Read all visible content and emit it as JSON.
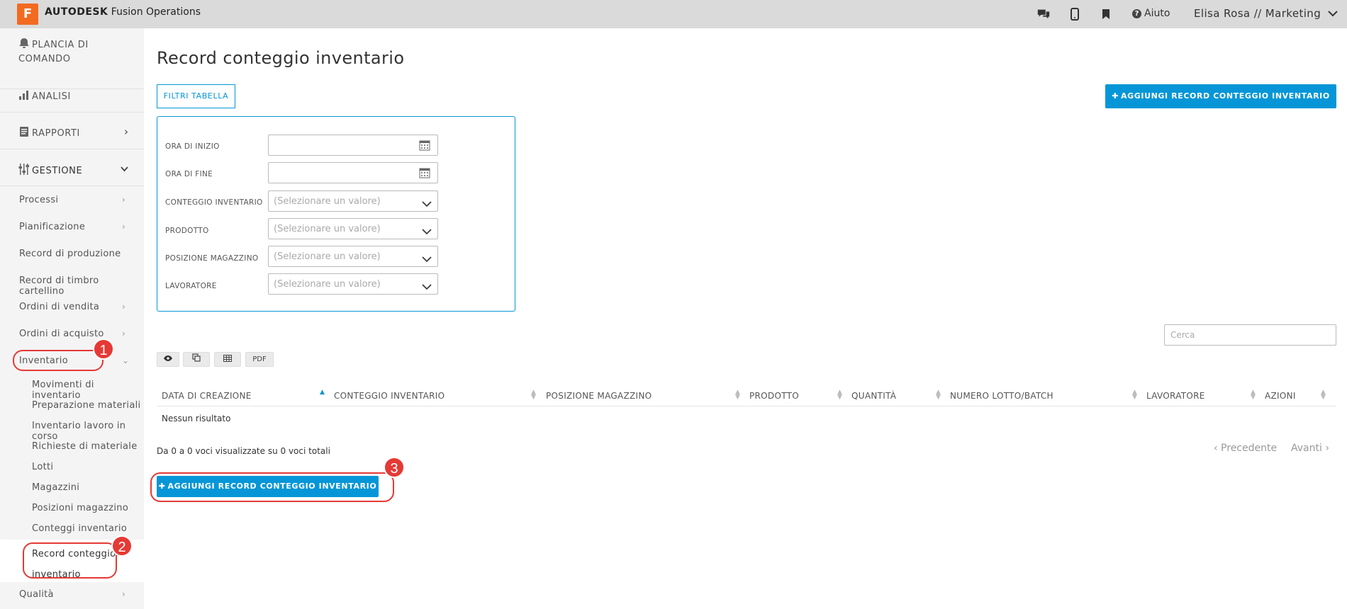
{
  "header": {
    "logo_letter": "F",
    "brand_strong": "AUTODESK",
    "brand_rest": "Fusion Operations",
    "help_label": "Aiuto",
    "user_label": "Elisa Rosa // Marketing"
  },
  "sidebar": {
    "dashboard_label": "PLANCIA DI COMANDO",
    "analytics_label": "ANALISI",
    "reports_label": "RAPPORTI",
    "management_label": "GESTIONE",
    "items": [
      {
        "label": "Processi"
      },
      {
        "label": "Pianificazione"
      },
      {
        "label": "Record di produzione"
      },
      {
        "label": "Record di timbro cartellino"
      },
      {
        "label": "Ordini di vendita"
      },
      {
        "label": "Ordini di acquisto"
      },
      {
        "label": "Inventario"
      }
    ],
    "inventory_sub": [
      {
        "label": "Movimenti di inventario"
      },
      {
        "label": "Preparazione materiali"
      },
      {
        "label": "Inventario lavoro in corso"
      },
      {
        "label": "Richieste di materiale"
      },
      {
        "label": "Lotti"
      },
      {
        "label": "Magazzini"
      },
      {
        "label": "Posizioni magazzino"
      },
      {
        "label": "Conteggi inventario"
      },
      {
        "label": "Record conteggio inventario"
      }
    ],
    "quality_label": "Qualità"
  },
  "main": {
    "title": "Record conteggio inventario",
    "filters_button": "FILTRI TABELLA",
    "add_button": "AGGIUNGI RECORD CONTEGGIO INVENTARIO",
    "add_button_bottom": "AGGIUNGI RECORD CONTEGGIO INVENTARIO",
    "filters": [
      {
        "label": "ORA DI INIZIO",
        "placeholder": ""
      },
      {
        "label": "ORA DI FINE",
        "placeholder": ""
      },
      {
        "label": "CONTEGGIO INVENTARIO",
        "placeholder": "(Selezionare un valore)"
      },
      {
        "label": "PRODOTTO",
        "placeholder": "(Selezionare un valore)"
      },
      {
        "label": "POSIZIONE MAGAZZINO",
        "placeholder": "(Selezionare un valore)"
      },
      {
        "label": "LAVORATORE",
        "placeholder": "(Selezionare un valore)"
      }
    ],
    "search_placeholder": "Cerca",
    "toolbar": {
      "pdf_label": "PDF"
    },
    "table": {
      "columns": [
        "DATA DI CREAZIONE",
        "CONTEGGIO INVENTARIO",
        "POSIZIONE MAGAZZINO",
        "PRODOTTO",
        "QUANTITÀ",
        "NUMERO LOTTO/BATCH",
        "LAVORATORE",
        "AZIONI"
      ],
      "empty_text": "Nessun risultato"
    },
    "info_text": "Da 0 a 0 voci visualizzate su 0 voci totali",
    "pager": {
      "prev": "‹ Precedente",
      "next": "Avanti ›"
    }
  },
  "annotations": [
    "1",
    "2",
    "3"
  ],
  "colors": {
    "accent": "#0696d7",
    "annotation": "#e53935",
    "logo": "#f26b21"
  }
}
